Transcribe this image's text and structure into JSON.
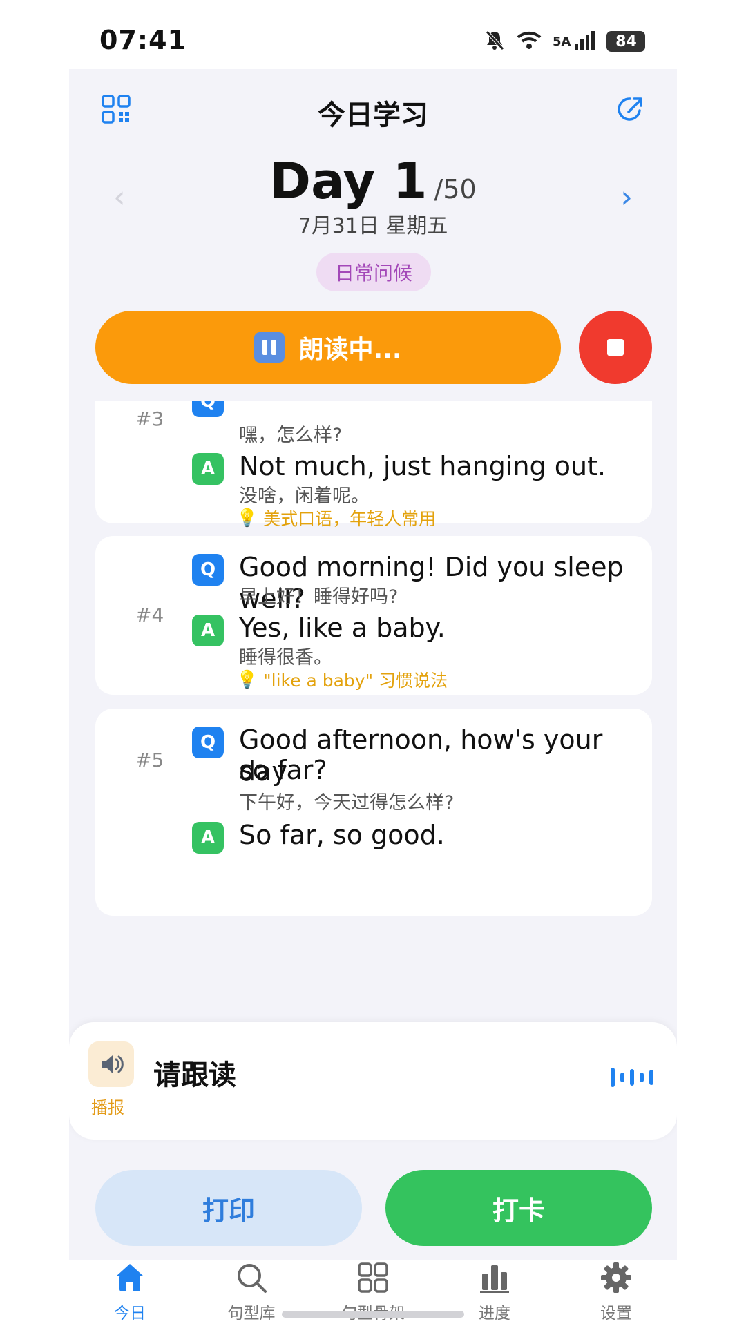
{
  "status_bar": {
    "time": "07:41",
    "network": "5A",
    "battery": "84"
  },
  "header": {
    "title": "今日学习",
    "left_icon": "qr-code-icon",
    "right_icon": "share-icon"
  },
  "day": {
    "label": "Day 1",
    "total": "/50",
    "date": "7月31日 星期五",
    "topic": "日常问候"
  },
  "player": {
    "status": "朗读中...",
    "pause_icon": "pause-icon",
    "stop_icon": "stop-icon",
    "bar_color": "#fb9a0b",
    "stop_color": "#f03a2e"
  },
  "items": [
    {
      "index": "#3",
      "q_badge": "Q",
      "a_badge": "A",
      "q_zh": "嘿，怎么样?",
      "a_en": "Not much, just hanging out.",
      "a_zh": "没啥，闲着呢。",
      "tip": "美式口语，年轻人常用"
    },
    {
      "index": "#4",
      "q_badge": "Q",
      "a_badge": "A",
      "q_en": "Good morning! Did you sleep well?",
      "q_zh": "早上好！睡得好吗?",
      "a_en": "Yes, like a baby.",
      "a_zh": "睡得很香。",
      "tip": "\"like a baby\" 习惯说法"
    },
    {
      "index": "#5",
      "q_badge": "Q",
      "a_badge": "A",
      "q_en_line1": "Good afternoon, how's your day",
      "q_en_line2": "so far?",
      "q_zh": "下午好，今天过得怎么样?",
      "a_en": "So far, so good."
    }
  ],
  "follow_panel": {
    "text": "请跟读",
    "speaker_label": "播报"
  },
  "actions": {
    "print": "打印",
    "checkin": "打卡"
  },
  "tabs": [
    {
      "label": "今日",
      "icon": "home-icon",
      "active": true
    },
    {
      "label": "句型库",
      "icon": "search-icon",
      "active": false
    },
    {
      "label": "句型骨架",
      "icon": "grid-icon",
      "active": false
    },
    {
      "label": "进度",
      "icon": "bar-chart-icon",
      "active": false
    },
    {
      "label": "设置",
      "icon": "gear-icon",
      "active": false
    }
  ],
  "colors": {
    "accent": "#1f82f0",
    "success": "#34c35e",
    "tip": "#e3a20d"
  }
}
